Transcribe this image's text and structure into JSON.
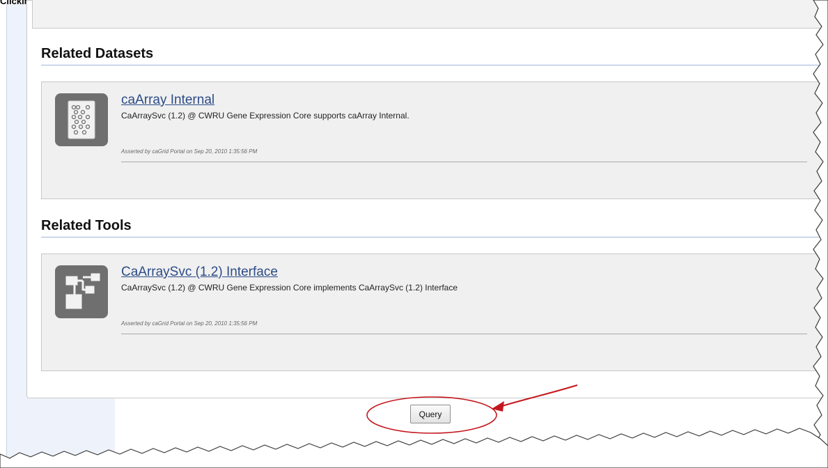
{
  "caption": "Clicking the Query button",
  "related_datasets": {
    "heading": "Related Datasets",
    "item": {
      "icon": "dataset-icon",
      "title": "caArray Internal",
      "description": "CaArraySvc (1.2) @ CWRU Gene Expression Core supports caArray Internal.",
      "asserted": "Asserted by caGrid Portal on Sep 20, 2010 1:35:56 PM"
    }
  },
  "related_tools": {
    "heading": "Related Tools",
    "item": {
      "icon": "tool-diagram-icon",
      "title": "CaArraySvc (1.2) Interface",
      "description": "CaArraySvc (1.2) @ CWRU Gene Expression Core implements CaArraySvc (1.2) Interface",
      "asserted": "Asserted by caGrid Portal on Sep 20, 2010 1:35:56 PM"
    }
  },
  "actions": {
    "query_label": "Query"
  },
  "colors": {
    "link": "#2c4c87",
    "annotation_red": "#c4161c",
    "card_background": "#f0f0f0",
    "icon_background": "#6f6f6f",
    "rail_background": "#eef2fb"
  }
}
